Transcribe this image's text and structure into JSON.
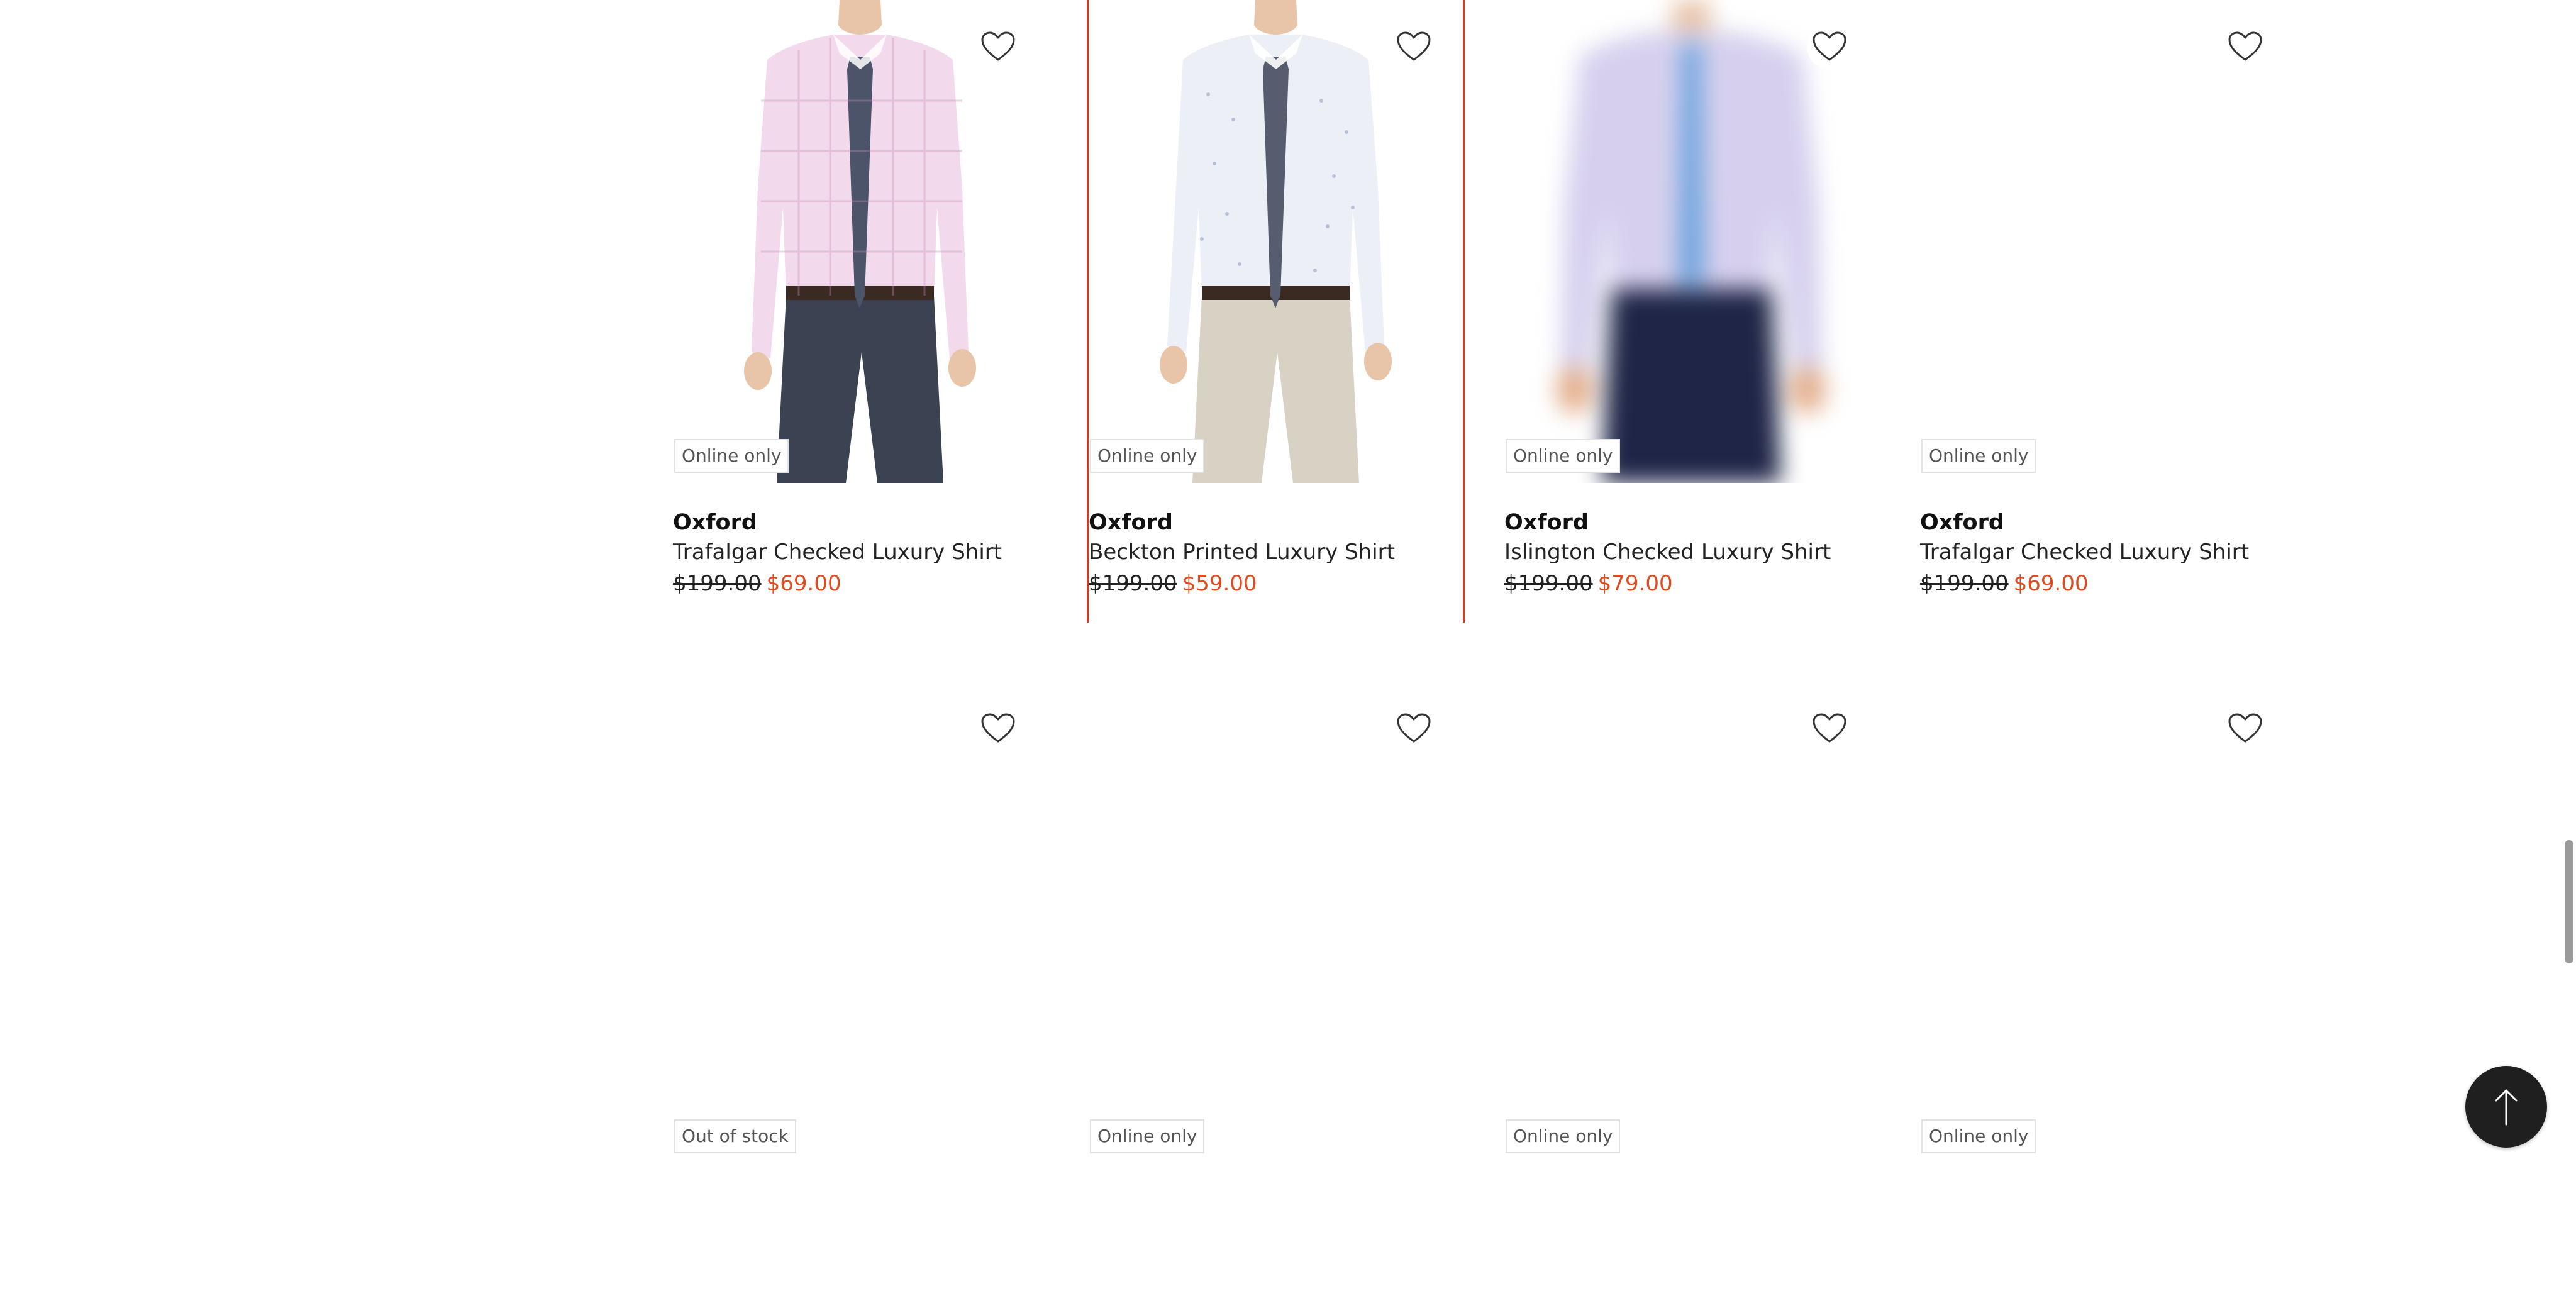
{
  "products_row1": [
    {
      "badge": "Online only",
      "brand": "Oxford",
      "name": "Trafalgar Checked Luxury Shirt",
      "was_price": "$199.00",
      "now_price": "$69.00",
      "shirt_color": "#f3d9ec",
      "pants_color": "#3b4252"
    },
    {
      "badge": "Online only",
      "brand": "Oxford",
      "name": "Beckton Printed Luxury Shirt",
      "was_price": "$199.00",
      "now_price": "$59.00",
      "shirt_color": "#eceff6",
      "pants_color": "#d8d2c4"
    },
    {
      "badge": "Online only",
      "brand": "Oxford",
      "name": "Islington Checked Luxury Shirt",
      "was_price": "$199.00",
      "now_price": "$79.00",
      "shirt_color": "#d6d0ee",
      "pants_color": "#1e2547"
    },
    {
      "badge": "Online only",
      "brand": "Oxford",
      "name": "Trafalgar Checked Luxury Shirt",
      "was_price": "$199.00",
      "now_price": "$69.00"
    }
  ],
  "products_row2": [
    {
      "badge": "Out of stock"
    },
    {
      "badge": "Online only"
    },
    {
      "badge": "Online only"
    },
    {
      "badge": "Online only"
    }
  ],
  "icons": {
    "wishlist": "heart-outline-icon",
    "back_to_top": "arrow-up-icon"
  },
  "colors": {
    "sale_price": "#e04a1f",
    "selected_border": "#d9381e",
    "back_to_top_bg": "#1f1f1f"
  }
}
